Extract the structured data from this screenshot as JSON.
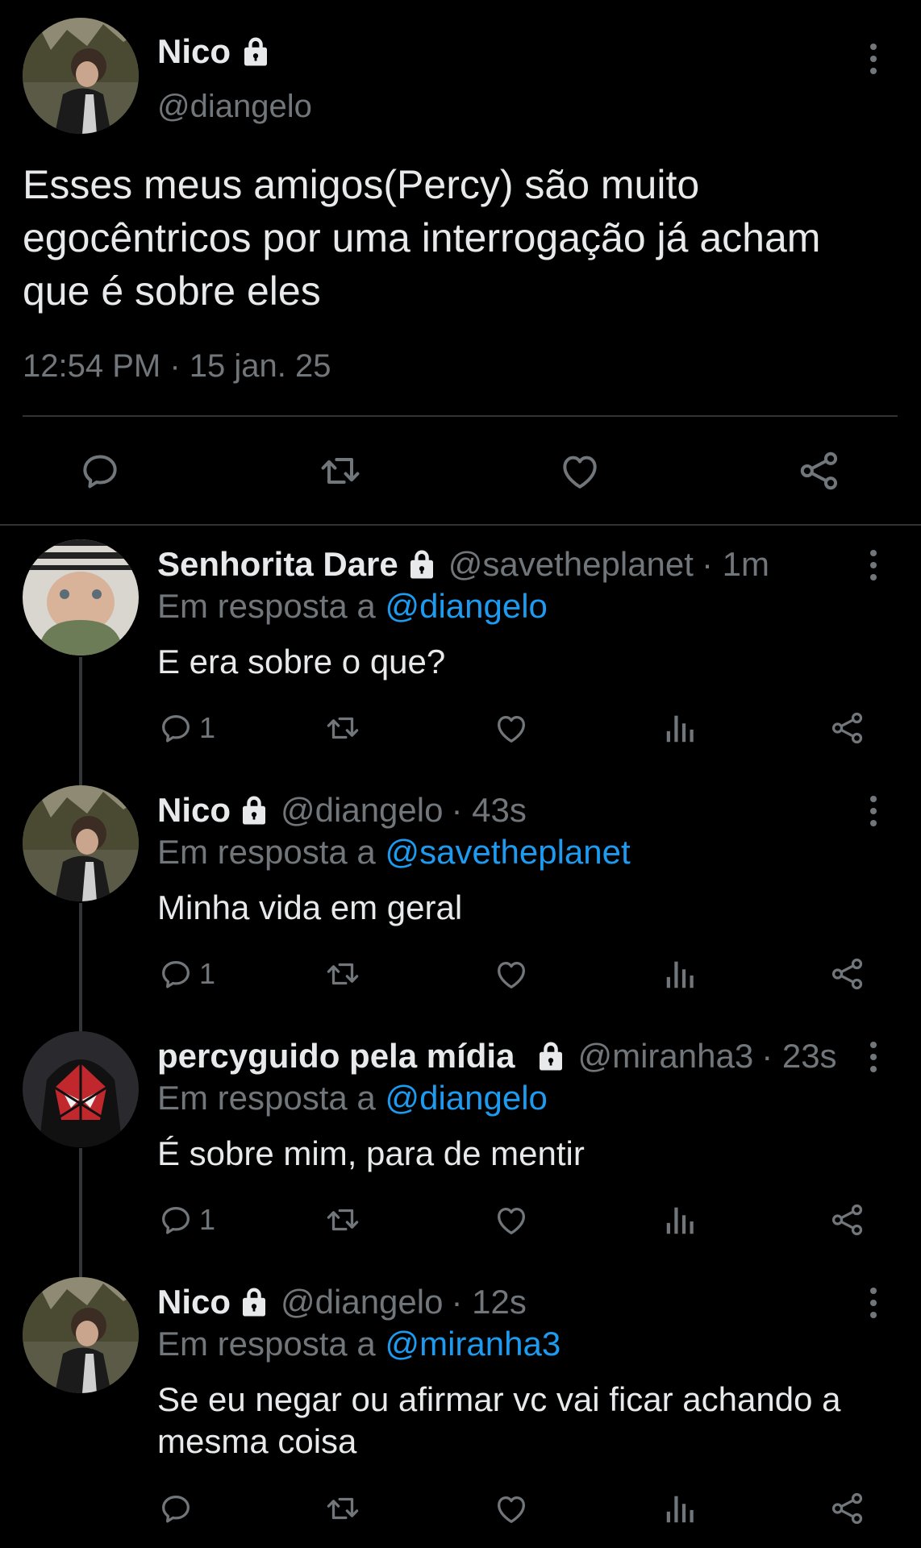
{
  "main_tweet": {
    "display_name": "Nico",
    "handle": "@diangelo",
    "text": "Esses meus amigos(Percy) são muito egocêntricos por uma interrogação já acham que é sobre eles",
    "timestamp": "12:54 PM · 15 jan. 25",
    "icons": [
      "lock-icon",
      "more-icon",
      "reply-icon",
      "retweet-icon",
      "like-icon",
      "share-icon"
    ]
  },
  "replies": [
    {
      "display_name": "Senhorita Dare",
      "handle": "@savetheplanet",
      "time": "· 1m",
      "reply_prefix": "Em resposta a",
      "reply_to": "@diangelo",
      "text": "E era sobre o que?",
      "reply_count": "1"
    },
    {
      "display_name": "Nico",
      "handle": "@diangelo",
      "time": "· 43s",
      "reply_prefix": "Em resposta a",
      "reply_to": "@savetheplanet",
      "text": "Minha vida em geral",
      "reply_count": "1"
    },
    {
      "display_name": "percyguido pela mídia",
      "handle": "@miranha3",
      "time": "· 23s",
      "reply_prefix": "Em resposta a",
      "reply_to": "@diangelo",
      "text": "É sobre mim, para de mentir",
      "reply_count": "1"
    },
    {
      "display_name": "Nico",
      "handle": "@diangelo",
      "time": "· 12s",
      "reply_prefix": "Em resposta a",
      "reply_to": "@miranha3",
      "text": "Se eu negar ou afirmar vc vai ficar achando a mesma coisa",
      "reply_count": ""
    }
  ],
  "colors": {
    "background": "#000000",
    "text": "#e7e9ea",
    "muted": "#71767b",
    "link": "#1d9bf0",
    "divider": "#2f3336"
  }
}
